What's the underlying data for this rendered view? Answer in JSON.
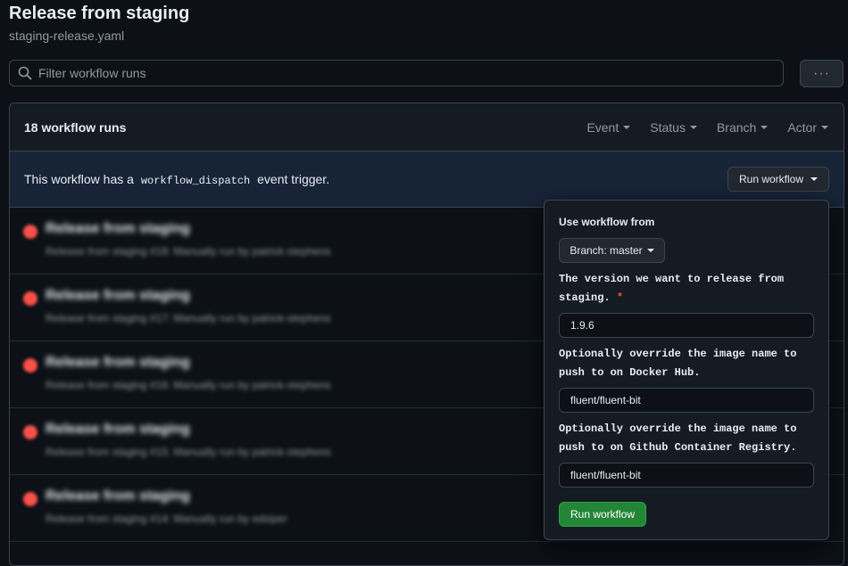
{
  "page": {
    "title": "Release from staging",
    "file": "staging-release.yaml"
  },
  "filter": {
    "placeholder": "Filter workflow runs",
    "more_label": "···"
  },
  "runs_header": {
    "count_label": "18 workflow runs",
    "filters": [
      "Event",
      "Status",
      "Branch",
      "Actor"
    ]
  },
  "banner": {
    "text_before": "This workflow has a",
    "code": "workflow_dispatch",
    "text_after": "event trigger.",
    "run_button": "Run workflow"
  },
  "runs": [
    {
      "title": "Release from staging",
      "meta": "Release from staging #18: Manually run by patrick-stephens"
    },
    {
      "title": "Release from staging",
      "meta": "Release from staging #17: Manually run by patrick-stephens"
    },
    {
      "title": "Release from staging",
      "meta": "Release from staging #16: Manually run by patrick-stephens"
    },
    {
      "title": "Release from staging",
      "meta": "Release from staging #15: Manually run by patrick-stephens"
    },
    {
      "title": "Release from staging",
      "meta": "Release from staging #14: Manually run by edsiper"
    }
  ],
  "popover": {
    "use_from_label": "Use workflow from",
    "branch_button": "Branch: master",
    "fields": [
      {
        "label": "The version we want to release from staging.",
        "required": "*",
        "value": "1.9.6"
      },
      {
        "label": "Optionally override the image name to push to on Docker Hub.",
        "required": "",
        "value": "fluent/fluent-bit"
      },
      {
        "label": "Optionally override the image name to push to on Github Container Registry.",
        "required": "",
        "value": "fluent/fluent-bit"
      }
    ],
    "submit_label": "Run workflow"
  },
  "colors": {
    "background": "#0d1117",
    "banner": "#172337",
    "primary_button": "#238636",
    "failure": "#f85149"
  }
}
